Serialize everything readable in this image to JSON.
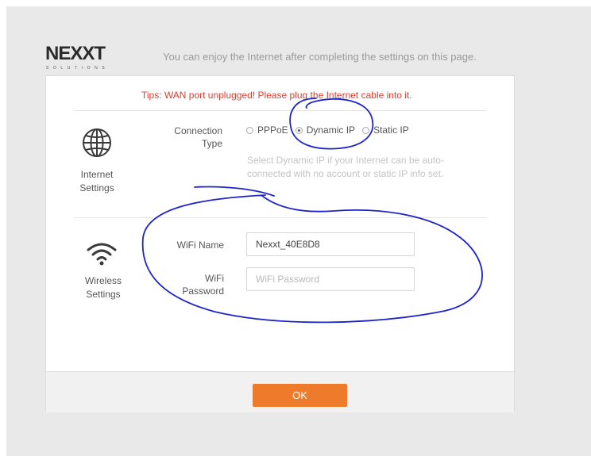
{
  "header": {
    "brand": "NEXXT",
    "brand_sub": "SOLUTIONS",
    "intro": "You can enjoy the Internet after completing the settings on this page."
  },
  "tip": "Tips: WAN port unplugged! Please plug the Internet cable into it.",
  "internet": {
    "label_line1": "Internet",
    "label_line2": "Settings",
    "icon": "globe-icon",
    "connection_type_line1": "Connection",
    "connection_type_line2": "Type",
    "options": [
      "PPPoE",
      "Dynamic IP",
      "Static IP"
    ],
    "selected": "Dynamic IP",
    "hint": "Select Dynamic IP if your Internet can be auto-connected with no account or static IP info set."
  },
  "wireless": {
    "label_line1": "Wireless",
    "label_line2": "Settings",
    "icon": "wifi-icon",
    "wifi_name_label": "WiFi Name",
    "wifi_name_value": "Nexxt_40E8D8",
    "wifi_password_label_line1": "WiFi",
    "wifi_password_label_line2": "Password",
    "wifi_password_placeholder": "WiFi Password"
  },
  "footer": {
    "ok_label": "OK"
  },
  "colors": {
    "tip": "#e03c2d",
    "ok_button": "#ee7b2c",
    "annotation": "#1f24c8"
  }
}
